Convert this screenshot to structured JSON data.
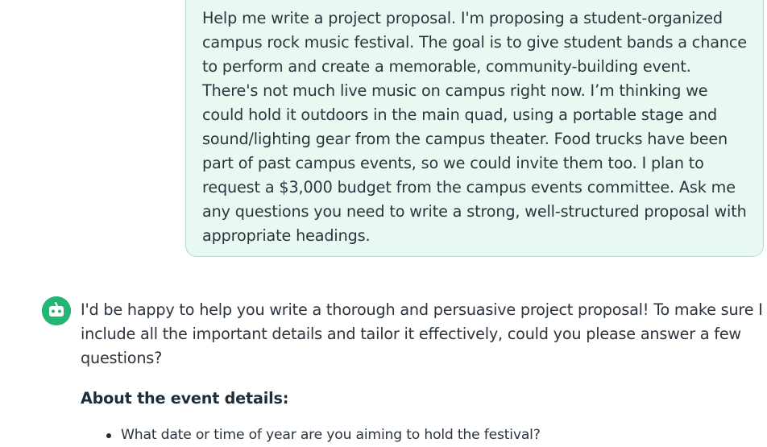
{
  "user_message": {
    "text": "Help me write a project proposal. I'm proposing a student-organized campus rock music festival. The goal is to give student bands a chance to perform and create a memorable, community-building event. There's not much live music on campus right now. I’m thinking we could hold it outdoors in the main quad, using a portable stage and sound/lighting gear from the campus theater. Food trucks have been part of past campus events, so we could invite them too. I plan to request a $3,000 budget from the campus events committee. Ask me any questions you need to write a strong, well-structured proposal with appropriate headings."
  },
  "assistant_message": {
    "avatar_icon": "robot-icon",
    "avatar_color": "#22b573",
    "intro": "I'd be happy to help you write a thorough and persuasive project proposal! To make sure I include all the important details and tailor it effectively, could you please answer a few questions?",
    "section_heading": "About the event details:",
    "questions": [
      "What date or time of year are you aiming to hold the festival?"
    ]
  },
  "colors": {
    "user_bubble_bg": "#e8f9f1",
    "user_bubble_border": "#b9d8c9",
    "text": "#2a3540"
  }
}
